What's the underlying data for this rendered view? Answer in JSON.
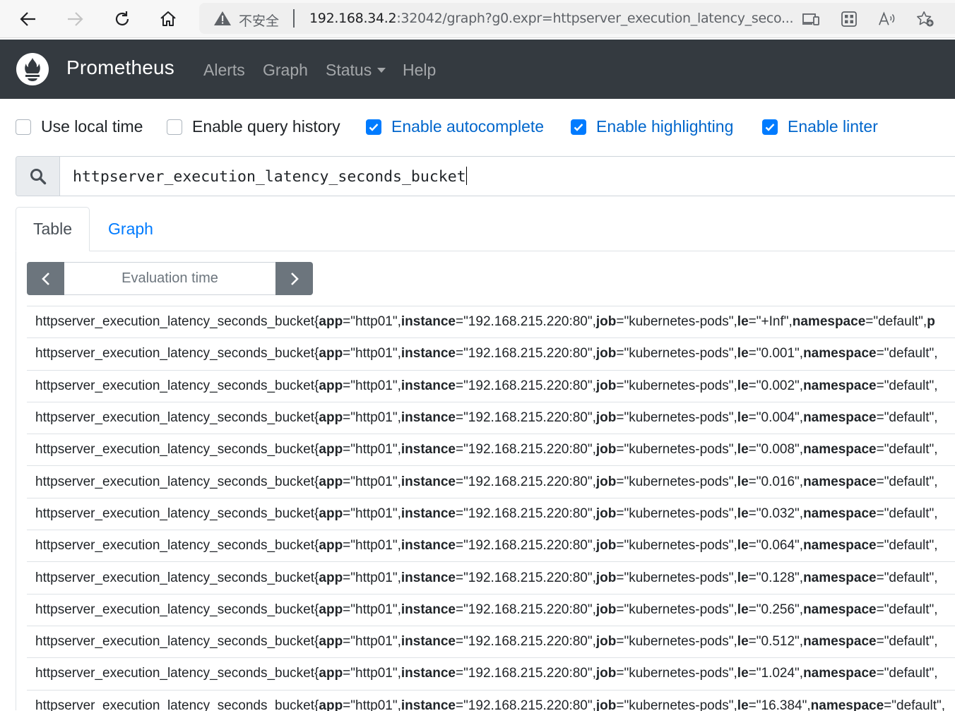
{
  "browser": {
    "insecure_label": "不安全",
    "url_host": "192.168.34.2",
    "url_rest": ":32042/graph?g0.expr=httpserver_execution_latency_seco..."
  },
  "navbar": {
    "brand": "Prometheus",
    "links": [
      "Alerts",
      "Graph",
      "Status",
      "Help"
    ]
  },
  "options": [
    {
      "label": "Use local time",
      "checked": false
    },
    {
      "label": "Enable query history",
      "checked": false
    },
    {
      "label": "Enable autocomplete",
      "checked": true
    },
    {
      "label": "Enable highlighting",
      "checked": true
    },
    {
      "label": "Enable linter",
      "checked": true
    }
  ],
  "query": {
    "expression": "httpserver_execution_latency_seconds_bucket"
  },
  "tabs": [
    "Table",
    "Graph"
  ],
  "eval_time": {
    "placeholder": "Evaluation time"
  },
  "results": {
    "metric_name": "httpserver_execution_latency_seconds_bucket",
    "rows": [
      {
        "app": "http01",
        "instance": "192.168.215.220:80",
        "job": "kubernetes-pods",
        "le": "+Inf",
        "namespace": "default",
        "tail": "p"
      },
      {
        "app": "http01",
        "instance": "192.168.215.220:80",
        "job": "kubernetes-pods",
        "le": "0.001",
        "namespace": "default",
        "tail": ""
      },
      {
        "app": "http01",
        "instance": "192.168.215.220:80",
        "job": "kubernetes-pods",
        "le": "0.002",
        "namespace": "default",
        "tail": ""
      },
      {
        "app": "http01",
        "instance": "192.168.215.220:80",
        "job": "kubernetes-pods",
        "le": "0.004",
        "namespace": "default",
        "tail": ""
      },
      {
        "app": "http01",
        "instance": "192.168.215.220:80",
        "job": "kubernetes-pods",
        "le": "0.008",
        "namespace": "default",
        "tail": ""
      },
      {
        "app": "http01",
        "instance": "192.168.215.220:80",
        "job": "kubernetes-pods",
        "le": "0.016",
        "namespace": "default",
        "tail": ""
      },
      {
        "app": "http01",
        "instance": "192.168.215.220:80",
        "job": "kubernetes-pods",
        "le": "0.032",
        "namespace": "default",
        "tail": ""
      },
      {
        "app": "http01",
        "instance": "192.168.215.220:80",
        "job": "kubernetes-pods",
        "le": "0.064",
        "namespace": "default",
        "tail": ""
      },
      {
        "app": "http01",
        "instance": "192.168.215.220:80",
        "job": "kubernetes-pods",
        "le": "0.128",
        "namespace": "default",
        "tail": ""
      },
      {
        "app": "http01",
        "instance": "192.168.215.220:80",
        "job": "kubernetes-pods",
        "le": "0.256",
        "namespace": "default",
        "tail": ""
      },
      {
        "app": "http01",
        "instance": "192.168.215.220:80",
        "job": "kubernetes-pods",
        "le": "0.512",
        "namespace": "default",
        "tail": ""
      },
      {
        "app": "http01",
        "instance": "192.168.215.220:80",
        "job": "kubernetes-pods",
        "le": "1.024",
        "namespace": "default",
        "tail": ""
      },
      {
        "app": "http01",
        "instance": "192.168.215.220:80",
        "job": "kubernetes-pods",
        "le": "16.384",
        "namespace": "default",
        "tail": ""
      }
    ]
  }
}
